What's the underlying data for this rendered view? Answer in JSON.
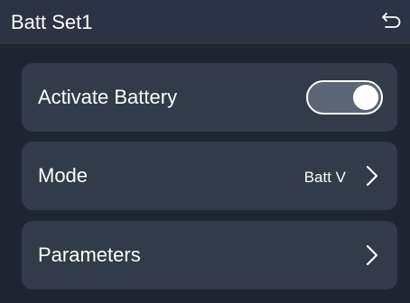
{
  "header": {
    "title": "Batt Set1",
    "back_icon": "return-icon"
  },
  "items": [
    {
      "label": "Activate Battery",
      "control": "toggle",
      "toggle_on": true
    },
    {
      "label": "Mode",
      "value": "Batt V",
      "control": "chevron"
    },
    {
      "label": "Parameters",
      "control": "chevron"
    }
  ],
  "colors": {
    "background": "#1f2631",
    "header": "#2a3444",
    "card": "#323b49",
    "toggle_track": "#5d6676",
    "text": "#ffffff"
  }
}
